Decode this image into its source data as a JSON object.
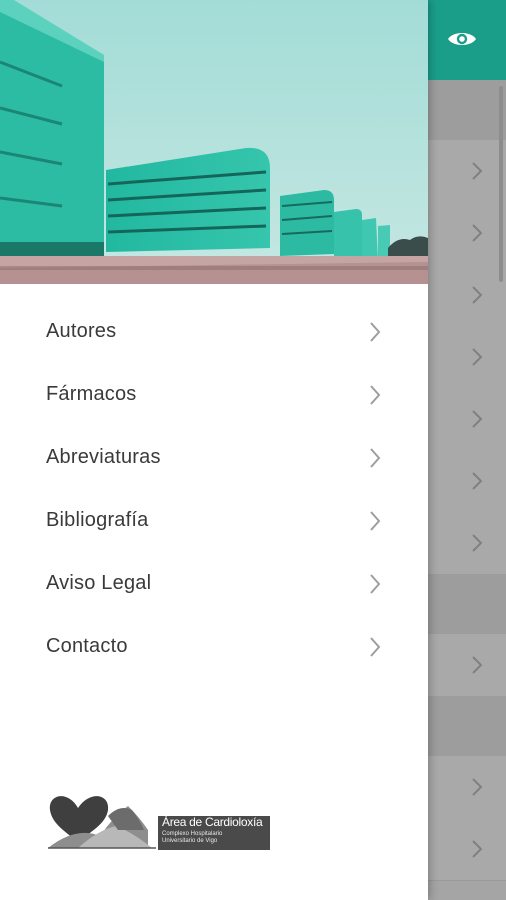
{
  "drawer": {
    "menu_items": [
      {
        "label": "Autores"
      },
      {
        "label": "Fármacos"
      },
      {
        "label": "Abreviaturas"
      },
      {
        "label": "Bibliografía"
      },
      {
        "label": "Aviso Legal"
      },
      {
        "label": "Contacto"
      }
    ],
    "logo": {
      "title": "Área de Cardioloxía",
      "subtitle_line1": "Complexo Hospitalario",
      "subtitle_line2": "Universitario de Vigo"
    }
  },
  "background_app": {
    "toolbar_icon": "eye-icon",
    "accent_color": "#1a9e8a"
  },
  "colors": {
    "toolbar": "#1a9e8a",
    "scrim": "#a5a5a5",
    "drawer_bg": "#ffffff",
    "menu_text": "#3a3a3a"
  }
}
